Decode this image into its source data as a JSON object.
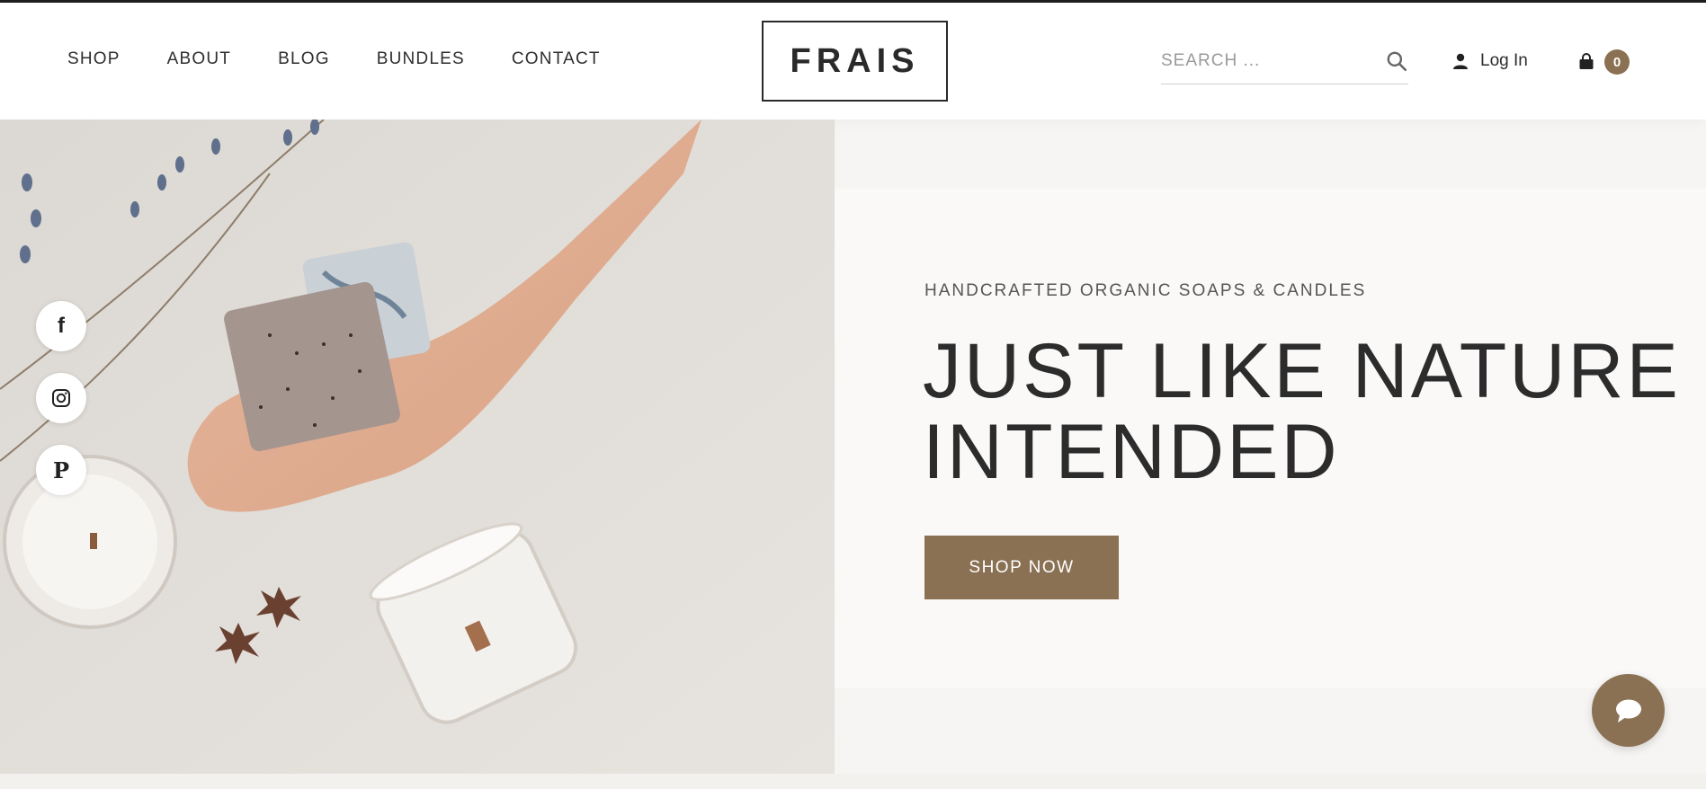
{
  "nav": {
    "items": [
      {
        "label": "SHOP"
      },
      {
        "label": "ABOUT"
      },
      {
        "label": "BLOG"
      },
      {
        "label": "BUNDLES"
      },
      {
        "label": "CONTACT"
      }
    ]
  },
  "logo": {
    "text": "FRAIS"
  },
  "search": {
    "placeholder": "SEARCH ..."
  },
  "account": {
    "login_label": "Log In"
  },
  "cart": {
    "count": "0"
  },
  "hero": {
    "tagline": "HANDCRAFTED ORGANIC SOAPS & CANDLES",
    "headline": "JUST LIKE NATURE INTENDED",
    "cta_label": "SHOP NOW"
  },
  "social": [
    {
      "icon": "facebook-icon",
      "glyph": "f"
    },
    {
      "icon": "instagram-icon"
    },
    {
      "icon": "pinterest-icon",
      "glyph": "P"
    }
  ],
  "colors": {
    "accent": "#8a7153",
    "text": "#2c2c2c"
  }
}
